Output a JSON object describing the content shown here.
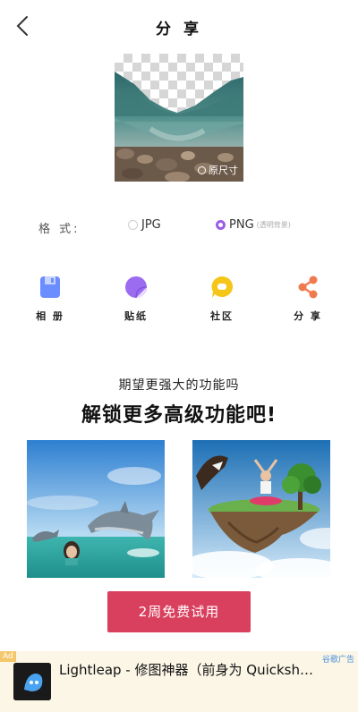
{
  "header": {
    "title": "分 享",
    "back_icon": "chevron-left-icon"
  },
  "preview": {
    "original_size_label": "原尺寸"
  },
  "format": {
    "label": "格   式:",
    "options": [
      {
        "label": "JPG",
        "sub": "",
        "selected": false
      },
      {
        "label": "PNG",
        "sub": "(透明背景)",
        "selected": true
      }
    ],
    "accent_color": "#9b5de5"
  },
  "actions": [
    {
      "label": "相 册",
      "icon": "save-album-icon",
      "color": "#6a8dff"
    },
    {
      "label": "贴纸",
      "icon": "sticker-icon",
      "color": "#9b6cf0"
    },
    {
      "label": "社区",
      "icon": "community-chat-icon",
      "color": "#f5c518"
    },
    {
      "label": "分 享",
      "icon": "share-icon",
      "color": "#f07a50"
    }
  ],
  "promo": {
    "subtitle": "期望更强大的功能吗",
    "title": "解锁更多高级功能吧!",
    "trial_button": "2周免费试用",
    "button_color": "#d8405e"
  },
  "ad": {
    "badge": "Ad",
    "network": "谷歌广告",
    "text": "Lightleap - 修图神器（前身为 Quicksh…"
  }
}
